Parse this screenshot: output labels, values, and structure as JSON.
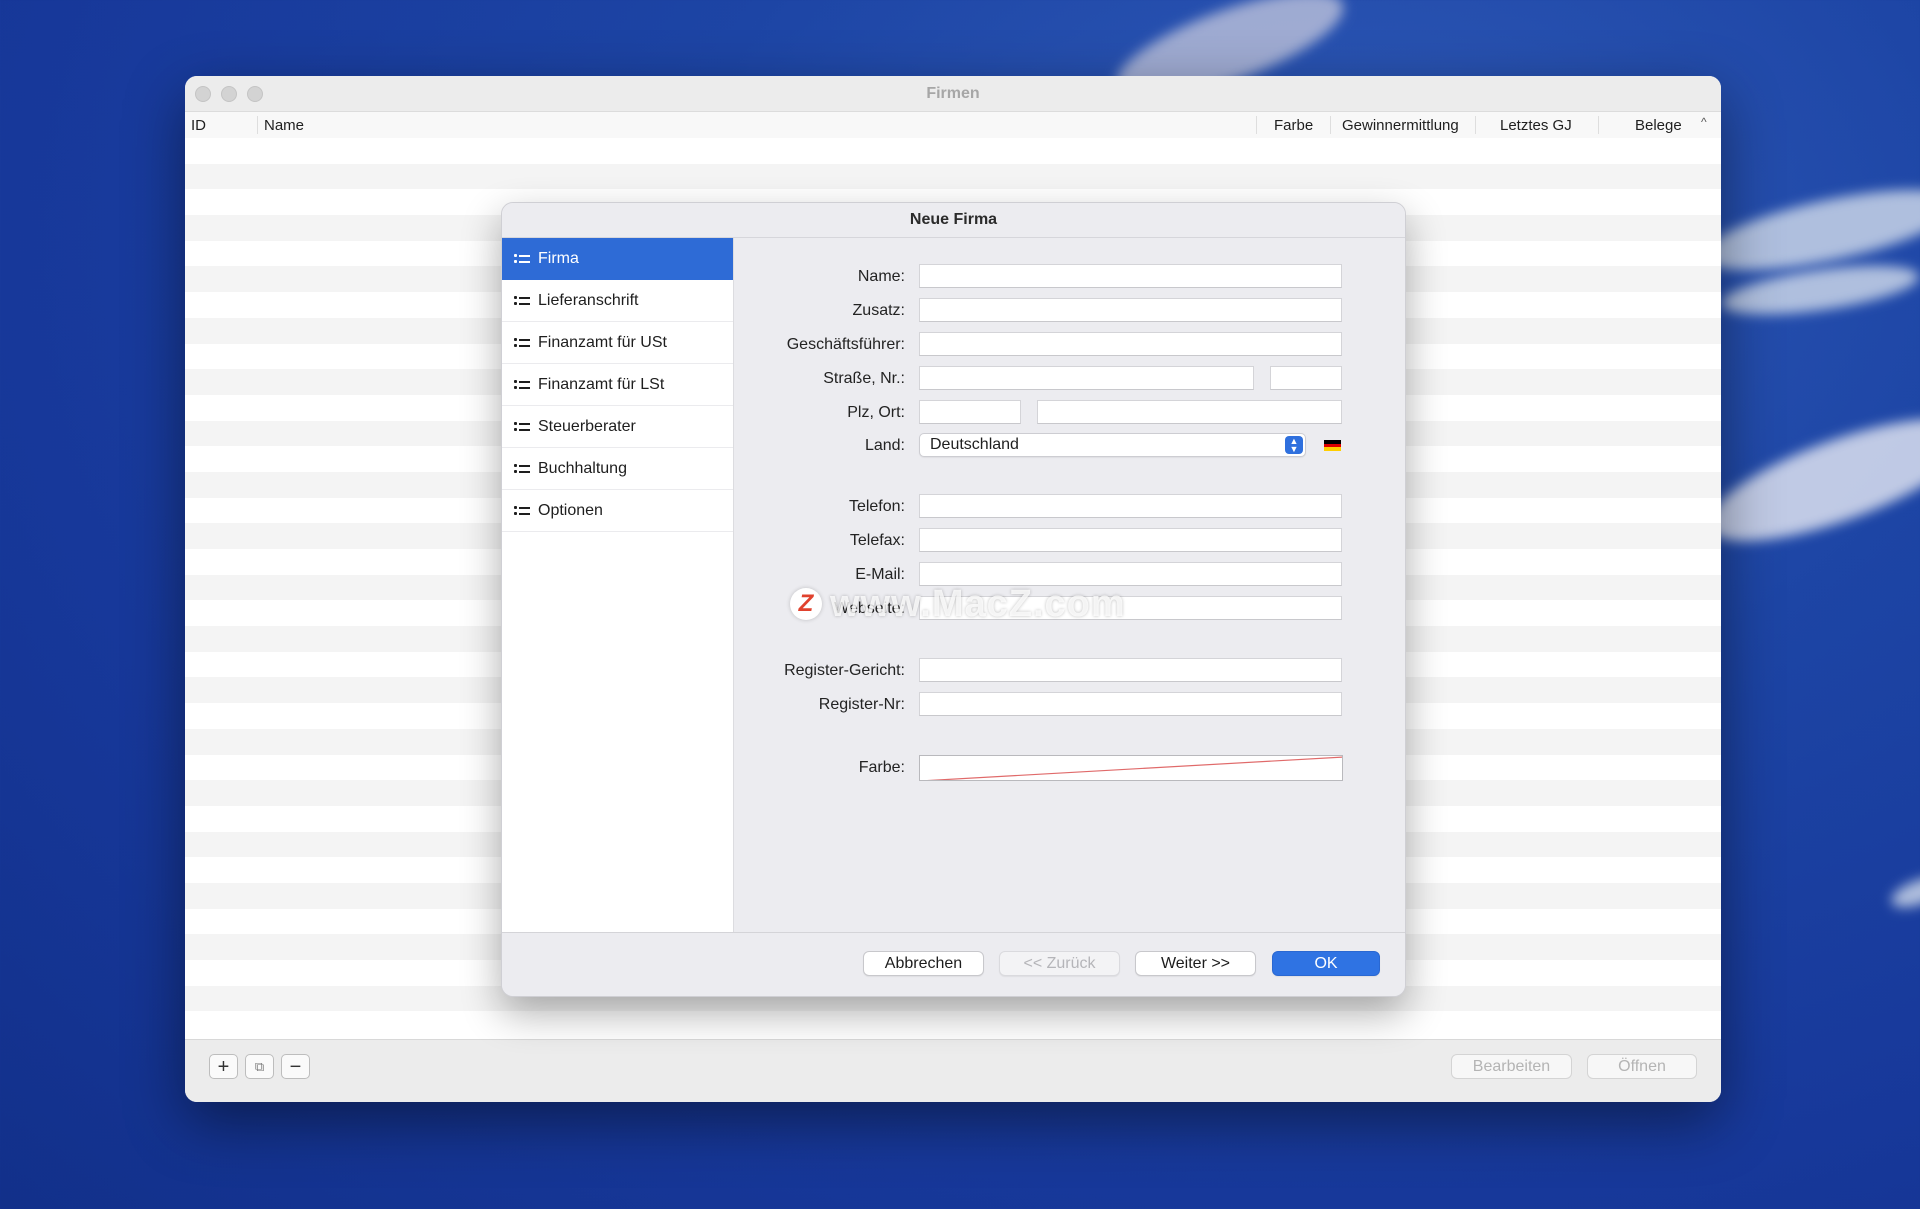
{
  "window": {
    "title": "Firmen",
    "columns": [
      "ID",
      "Name",
      "Farbe",
      "Gewinnermittlung",
      "Letztes GJ",
      "Belege"
    ],
    "sort_indicator": "^",
    "bottom_buttons": {
      "add": "+",
      "duplicate": "⧉",
      "remove": "−",
      "edit": "Bearbeiten",
      "open": "Öffnen"
    }
  },
  "sheet": {
    "title": "Neue Firma",
    "sidebar": [
      {
        "label": "Firma",
        "active": true
      },
      {
        "label": "Lieferanschrift",
        "active": false
      },
      {
        "label": "Finanzamt für USt",
        "active": false
      },
      {
        "label": "Finanzamt für LSt",
        "active": false
      },
      {
        "label": "Steuerberater",
        "active": false
      },
      {
        "label": "Buchhaltung",
        "active": false
      },
      {
        "label": "Optionen",
        "active": false
      }
    ],
    "form": {
      "name_label": "Name:",
      "name_value": "",
      "zusatz_label": "Zusatz:",
      "zusatz_value": "",
      "geschaeftsfuehrer_label": "Geschäftsführer:",
      "geschaeftsfuehrer_value": "",
      "strasse_label": "Straße, Nr.:",
      "strasse_value": "",
      "nr_value": "",
      "plz_ort_label": "Plz, Ort:",
      "plz_value": "",
      "ort_value": "",
      "land_label": "Land:",
      "land_value": "Deutschland",
      "flag_colors": [
        "#000000",
        "#dd0000",
        "#ffce00"
      ],
      "telefon_label": "Telefon:",
      "telefon_value": "",
      "telefax_label": "Telefax:",
      "telefax_value": "",
      "email_label": "E-Mail:",
      "email_value": "",
      "webseite_label": "Webseite:",
      "webseite_value": "",
      "register_gericht_label": "Register-Gericht:",
      "register_gericht_value": "",
      "register_nr_label": "Register-Nr:",
      "register_nr_value": "",
      "farbe_label": "Farbe:"
    },
    "footer": {
      "cancel": "Abbrechen",
      "back": "<< Zurück",
      "next": "Weiter >>",
      "ok": "OK"
    }
  },
  "watermark": {
    "logo": "Z",
    "text": "www.MacZ.com"
  },
  "colors": {
    "accent": "#2e6bd6",
    "ok_button": "#2f73e3"
  }
}
